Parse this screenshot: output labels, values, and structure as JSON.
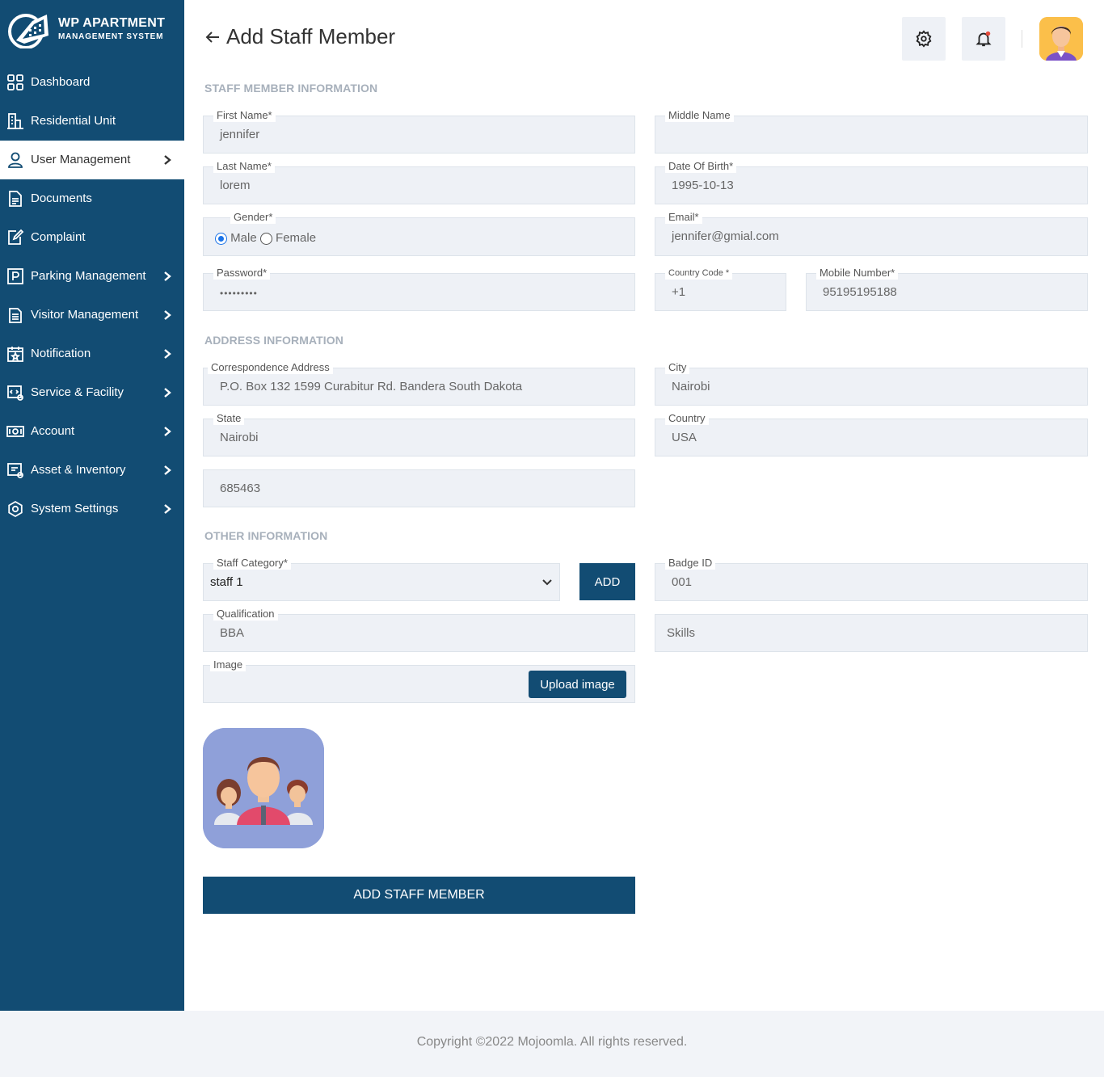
{
  "brand": {
    "line1": "WP APARTMENT",
    "line2": "MANAGEMENT SYSTEM"
  },
  "sidebar": {
    "items": [
      {
        "label": "Dashboard",
        "icon": "grid-icon",
        "chevron": false,
        "active": false
      },
      {
        "label": "Residential Unit",
        "icon": "building-icon",
        "chevron": false,
        "active": false
      },
      {
        "label": "User Management",
        "icon": "user-icon",
        "chevron": true,
        "active": true
      },
      {
        "label": "Documents",
        "icon": "document-icon",
        "chevron": false,
        "active": false
      },
      {
        "label": "Complaint",
        "icon": "edit-icon",
        "chevron": false,
        "active": false
      },
      {
        "label": "Parking Management",
        "icon": "parking-icon",
        "chevron": true,
        "active": false
      },
      {
        "label": "Visitor Management",
        "icon": "clipboard-icon",
        "chevron": true,
        "active": false
      },
      {
        "label": "Notification",
        "icon": "calendar-star-icon",
        "chevron": true,
        "active": false
      },
      {
        "label": "Service & Facility",
        "icon": "service-icon",
        "chevron": true,
        "active": false
      },
      {
        "label": "Account",
        "icon": "cash-icon",
        "chevron": true,
        "active": false
      },
      {
        "label": "Asset & Inventory",
        "icon": "asset-icon",
        "chevron": true,
        "active": false
      },
      {
        "label": "System Settings",
        "icon": "settings-icon",
        "chevron": true,
        "active": false
      }
    ]
  },
  "header": {
    "title": "Add Staff Member"
  },
  "sections": {
    "staff": "STAFF MEMBER INFORMATION",
    "address": "ADDRESS INFORMATION",
    "other": "OTHER INFORMATION"
  },
  "form": {
    "first_name": {
      "label": "First Name*",
      "value": "jennifer"
    },
    "middle_name": {
      "label": "Middle Name",
      "value": ""
    },
    "last_name": {
      "label": "Last Name*",
      "value": "lorem"
    },
    "dob": {
      "label": "Date Of Birth*",
      "value": "1995-10-13"
    },
    "gender": {
      "label": "Gender*",
      "options": [
        "Male",
        "Female"
      ],
      "selected": "Male"
    },
    "email": {
      "label": "Email*",
      "value": "jennifer@gmial.com"
    },
    "password": {
      "label": "Password*",
      "value": "•••••••••"
    },
    "country_code": {
      "label": "Country Code *",
      "value": "+1"
    },
    "mobile": {
      "label": "Mobile Number*",
      "value": "95195195188"
    },
    "address": {
      "label": "Correspondence Address",
      "value": "P.O. Box 132 1599 Curabitur Rd. Bandera South Dakota"
    },
    "city": {
      "label": "City",
      "value": "Nairobi"
    },
    "state": {
      "label": "State",
      "value": "Nairobi"
    },
    "country": {
      "label": "Country",
      "value": "USA"
    },
    "zipcode": {
      "value": "685463"
    },
    "staff_category": {
      "label": "Staff Category*",
      "value": "staff 1"
    },
    "add_button": "ADD",
    "badge_id": {
      "label": "Badge ID",
      "value": "001"
    },
    "qualification": {
      "label": "Qualification",
      "value": "BBA"
    },
    "skills": {
      "placeholder": "Skills"
    },
    "image": {
      "label": "Image",
      "button": "Upload image"
    },
    "submit": "ADD STAFF MEMBER"
  },
  "footer": {
    "text": "Copyright ©2022 Mojoomla. All rights reserved."
  },
  "colors": {
    "sidebar": "#124c73",
    "field_bg": "#eef1f6",
    "accent": "#124c73",
    "notification_dot": "#e74c3c"
  }
}
